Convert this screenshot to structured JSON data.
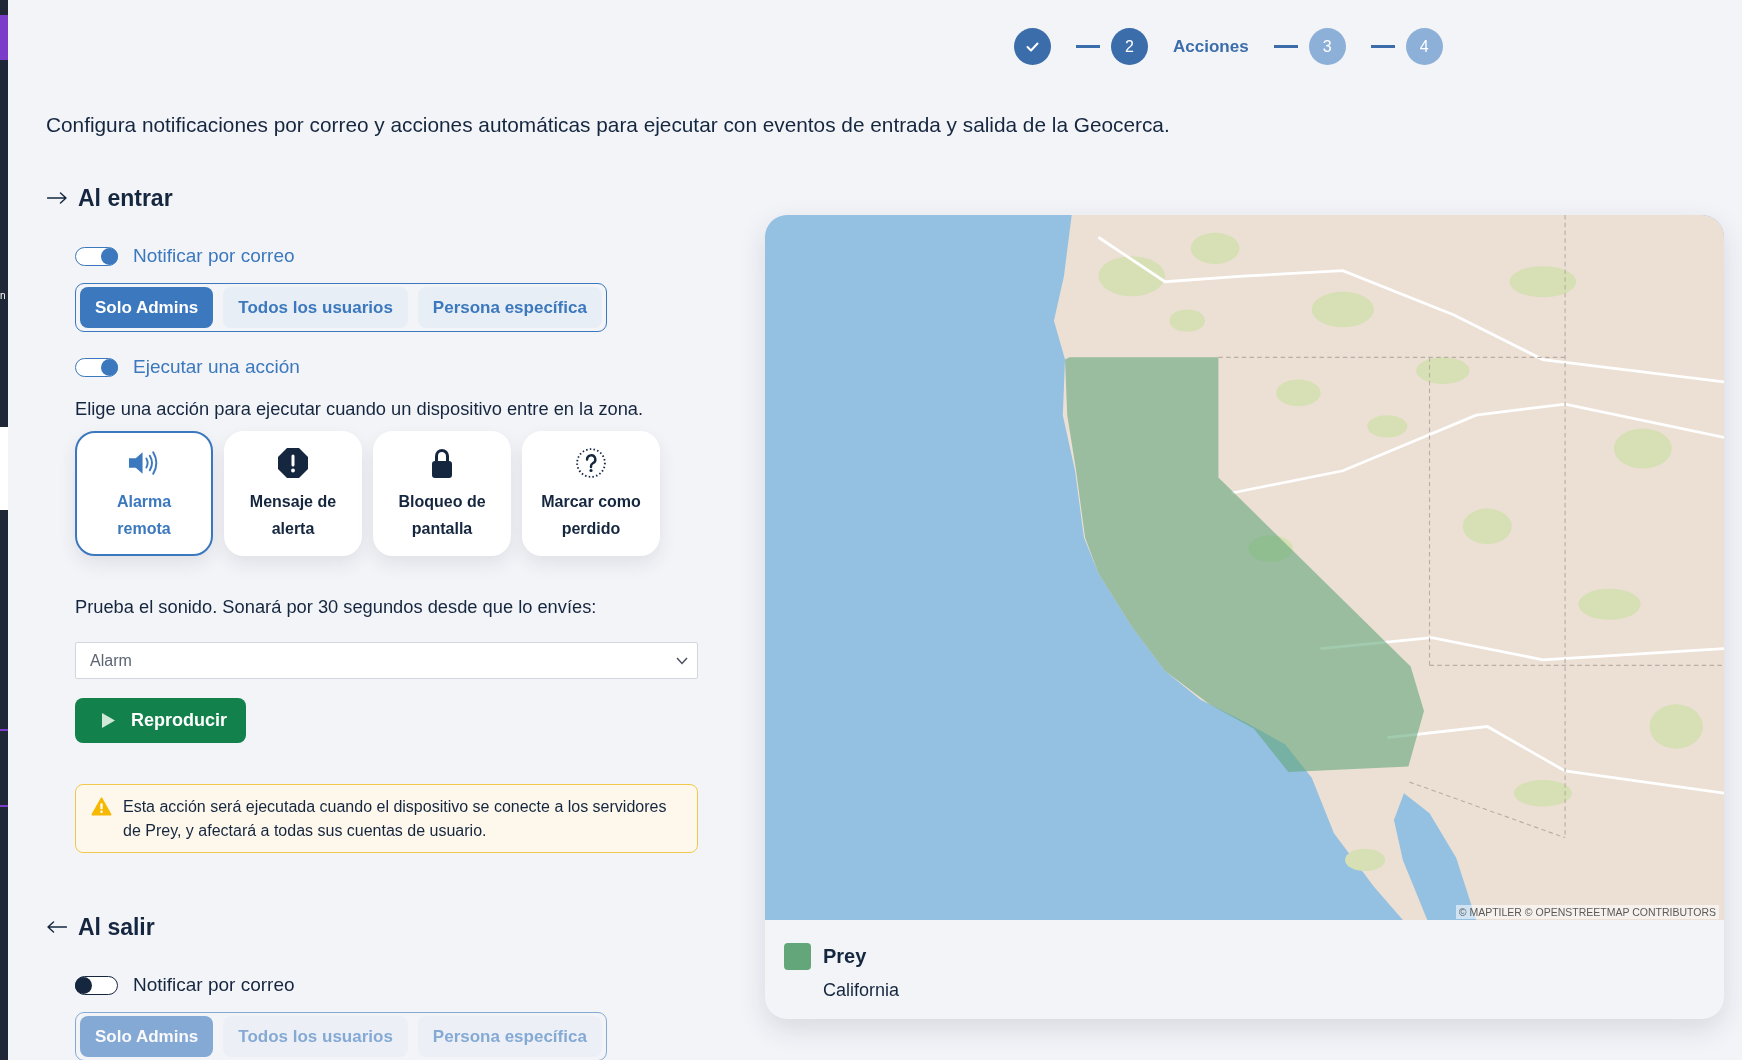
{
  "sidebar": {
    "label": "n"
  },
  "stepper": {
    "steps": [
      {
        "completed": true,
        "selected": false
      },
      {
        "number": "2",
        "title": "Acciones",
        "completed": false,
        "selected": true
      },
      {
        "number": "3",
        "completed": false,
        "selected": false
      },
      {
        "number": "4",
        "completed": false,
        "selected": false
      }
    ]
  },
  "description": "Configura notificaciones por correo y acciones automáticas para ejecutar con eventos de entrada y salida de la Geocerca.",
  "sections": [
    {
      "kind": "enter",
      "title": "Al entrar",
      "items": [
        {
          "kind": "toggle",
          "label": "Notificar por correo",
          "on": true
        },
        {
          "kind": "segmented",
          "disabled": false,
          "options": [
            {
              "label": "Solo Admins",
              "selected": true
            },
            {
              "label": "Todos los usuarios",
              "selected": false
            },
            {
              "label": "Persona específica",
              "selected": false
            }
          ]
        },
        {
          "kind": "toggle",
          "label": "Ejecutar una acción",
          "on": true
        },
        {
          "kind": "text",
          "text": "Elige una acción para ejecutar cuando un dispositivo entre en la zona."
        },
        {
          "kind": "cards",
          "cards": [
            {
              "kind": "speaker",
              "label": "Alarma remota",
              "selected": true
            },
            {
              "kind": "alert",
              "label": "Mensaje de alerta",
              "selected": false
            },
            {
              "kind": "lock",
              "label": "Bloqueo de pantalla",
              "selected": false
            },
            {
              "kind": "question",
              "label": "Marcar como perdido",
              "selected": false
            }
          ]
        },
        {
          "kind": "text",
          "text": "Prueba el sonido. Sonará por 30 segundos desde que lo envíes:"
        },
        {
          "kind": "select",
          "value": "Alarm"
        },
        {
          "kind": "button",
          "label": "Reproducir"
        },
        {
          "kind": "notice",
          "text": "Esta acción será ejecutada cuando el dispositivo se conecte a los servidores de Prey, y afectará a todas sus cuentas de usuario."
        }
      ]
    },
    {
      "kind": "exit",
      "title": "Al salir",
      "items": [
        {
          "kind": "toggle",
          "label": "Notificar por correo",
          "on": false
        },
        {
          "kind": "segmented",
          "disabled": true,
          "options": [
            {
              "label": "Solo Admins",
              "selected": true
            },
            {
              "label": "Todos los usuarios",
              "selected": false
            },
            {
              "label": "Persona específica",
              "selected": false
            }
          ]
        }
      ]
    }
  ],
  "map": {
    "attribution": "© MAPTILER © OPENSTREETMAP CONTRIBUTORS",
    "legend": [
      {
        "title": "Prey",
        "subtitle": "California",
        "color": "#62a679"
      }
    ]
  }
}
